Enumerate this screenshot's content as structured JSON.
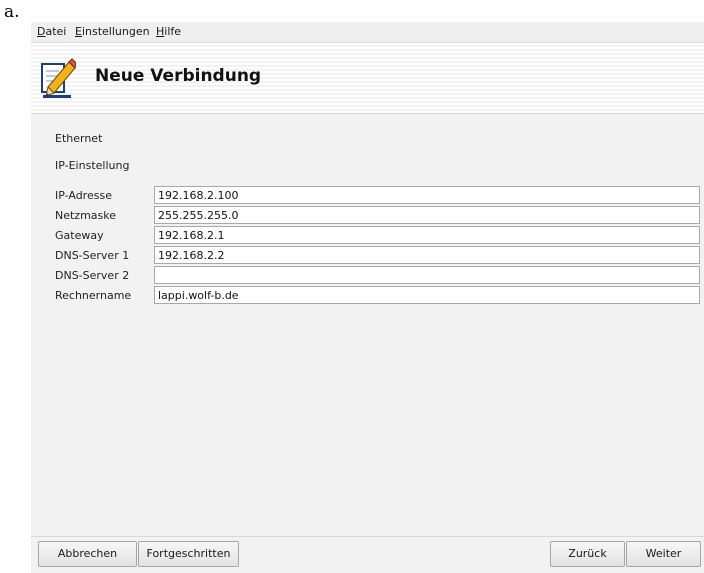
{
  "page_label": "a.",
  "menu": [
    {
      "mnemonic": "D",
      "rest": "atei"
    },
    {
      "mnemonic": "E",
      "rest": "instellungen"
    },
    {
      "mnemonic": "H",
      "rest": "ilfe"
    }
  ],
  "header": {
    "title": "Neue Verbindung",
    "icon": "pencil-on-paper-icon"
  },
  "sections": {
    "connection_type": "Ethernet",
    "ip_settings": "IP-Einstellung"
  },
  "fields": {
    "ip_address": {
      "label": "IP-Adresse",
      "value": "192.168.2.100"
    },
    "netmask": {
      "label": "Netzmaske",
      "value": "255.255.255.0"
    },
    "gateway": {
      "label": "Gateway",
      "value": "192.168.2.1"
    },
    "dns1": {
      "label": "DNS-Server 1",
      "value": "192.168.2.2"
    },
    "dns2": {
      "label": "DNS-Server 2",
      "value": ""
    },
    "hostname": {
      "label": "Rechnername",
      "value": "lappi.wolf-b.de"
    }
  },
  "buttons": {
    "cancel": "Abbrechen",
    "advanced": "Fortgeschritten",
    "back": "Zurück",
    "next": "Weiter"
  }
}
